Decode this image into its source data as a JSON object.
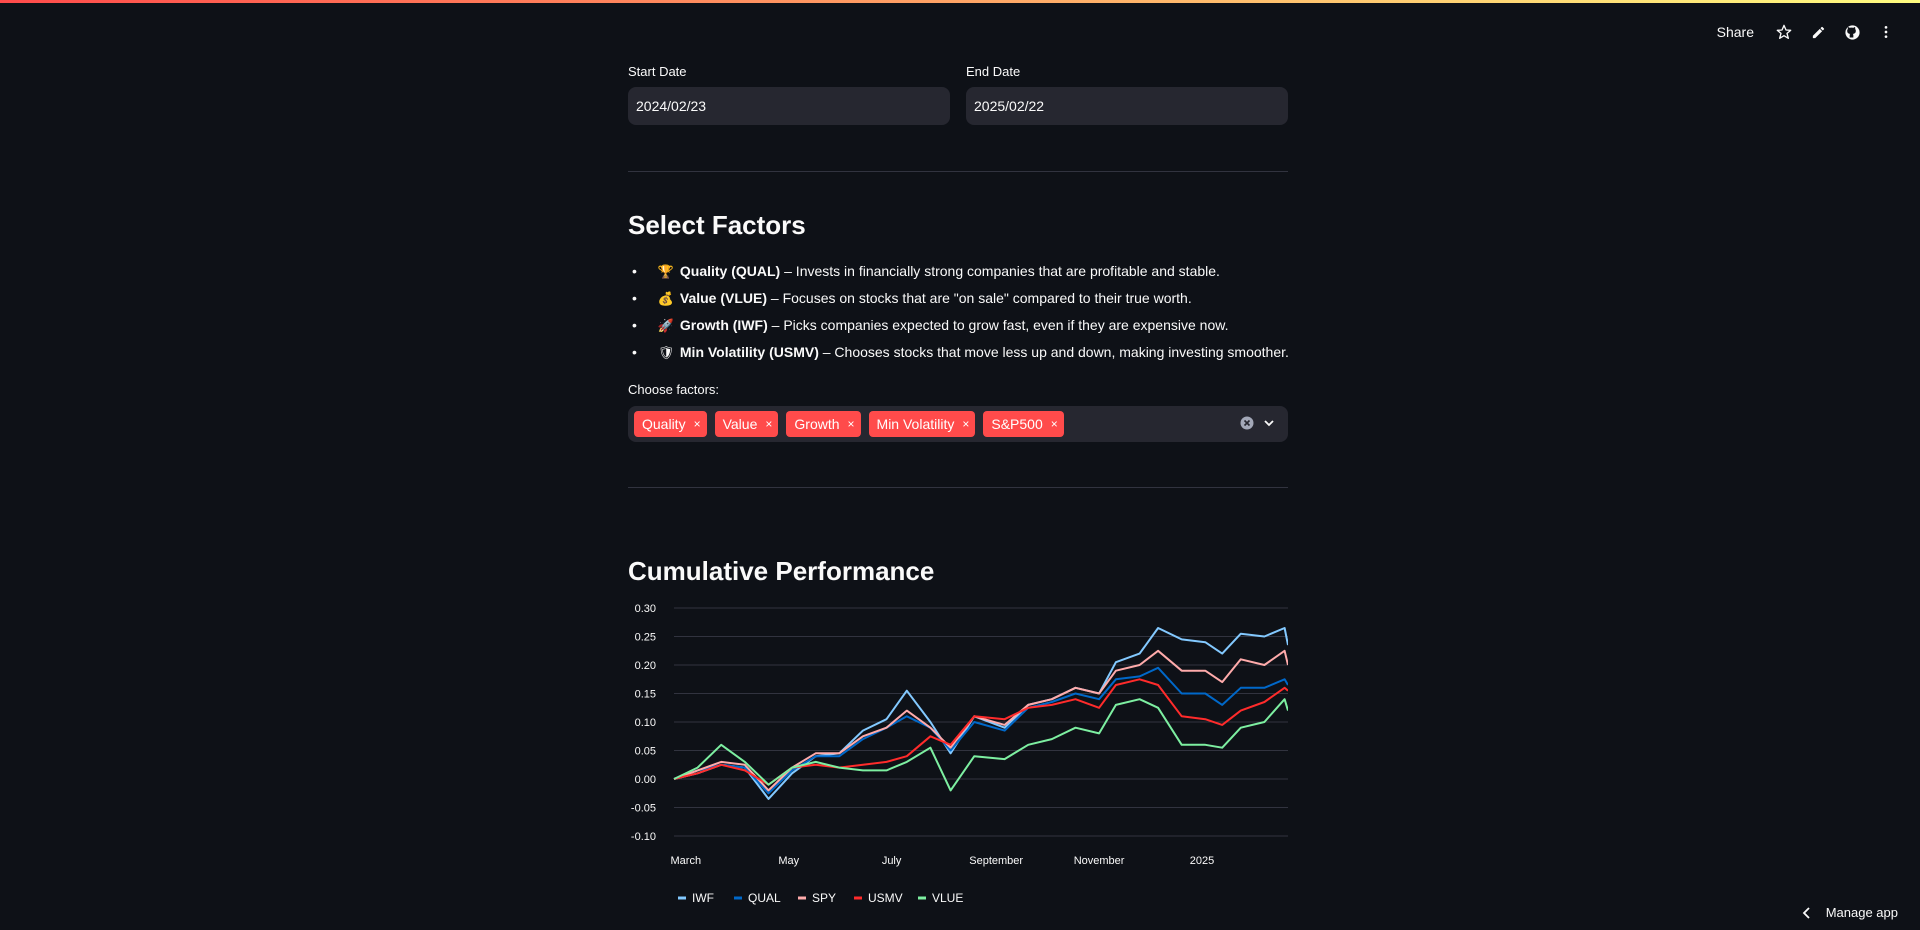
{
  "header": {
    "share_label": "Share",
    "icons": [
      "star-icon",
      "pencil-icon",
      "github-icon",
      "more-vertical-icon"
    ]
  },
  "dates": {
    "start_label": "Start Date",
    "start_value": "2024/02/23",
    "end_label": "End Date",
    "end_value": "2025/02/22"
  },
  "factors": {
    "title": "Select Factors",
    "items": [
      {
        "emoji": "🏆",
        "name": "Quality (QUAL)",
        "desc": "– Invests in financially strong companies that are profitable and stable."
      },
      {
        "emoji": "💰",
        "name": "Value (VLUE)",
        "desc": "– Focuses on stocks that are \"on sale\" compared to their true worth."
      },
      {
        "emoji": "🚀",
        "name": "Growth (IWF)",
        "desc": "– Picks companies expected to grow fast, even if they are expensive now."
      },
      {
        "emoji": "🛡",
        "name": "Min Volatility (USMV)",
        "desc": "– Chooses stocks that move less up and down, making investing smoother."
      }
    ],
    "choose_label": "Choose factors:",
    "selected": [
      "Quality",
      "Value",
      "Growth",
      "Min Volatility",
      "S&P500"
    ],
    "remove_glyph": "×"
  },
  "performance": {
    "title": "Cumulative Performance"
  },
  "chart_data": {
    "type": "line",
    "title": "",
    "xlabel": "",
    "ylabel": "",
    "x_ticks": [
      "March",
      "May",
      "July",
      "September",
      "November",
      "2025"
    ],
    "y_ticks": [
      "0.30",
      "0.25",
      "0.20",
      "0.15",
      "0.10",
      "0.05",
      "0.00",
      "-0.05",
      "-0.10"
    ],
    "ylim": [
      -0.1,
      0.3
    ],
    "xlim": [
      "2024-02-23",
      "2025-02-21"
    ],
    "grid": true,
    "legend": "bottom",
    "series": [
      {
        "name": "IWF",
        "color": "#83c9ff",
        "points": [
          [
            "2024-02-23",
            0.0
          ],
          [
            "2024-03-08",
            0.01
          ],
          [
            "2024-03-22",
            0.025
          ],
          [
            "2024-04-05",
            0.02
          ],
          [
            "2024-04-19",
            -0.035
          ],
          [
            "2024-05-03",
            0.01
          ],
          [
            "2024-05-17",
            0.04
          ],
          [
            "2024-05-31",
            0.045
          ],
          [
            "2024-06-14",
            0.085
          ],
          [
            "2024-06-28",
            0.105
          ],
          [
            "2024-07-10",
            0.155
          ],
          [
            "2024-07-24",
            0.1
          ],
          [
            "2024-08-05",
            0.045
          ],
          [
            "2024-08-19",
            0.11
          ],
          [
            "2024-09-06",
            0.09
          ],
          [
            "2024-09-20",
            0.13
          ],
          [
            "2024-10-04",
            0.14
          ],
          [
            "2024-10-18",
            0.16
          ],
          [
            "2024-11-01",
            0.15
          ],
          [
            "2024-11-11",
            0.205
          ],
          [
            "2024-11-25",
            0.22
          ],
          [
            "2024-12-06",
            0.265
          ],
          [
            "2024-12-20",
            0.245
          ],
          [
            "2025-01-03",
            0.24
          ],
          [
            "2025-01-13",
            0.22
          ],
          [
            "2025-01-24",
            0.255
          ],
          [
            "2025-02-07",
            0.25
          ],
          [
            "2025-02-19",
            0.265
          ],
          [
            "2025-02-21",
            0.235
          ]
        ]
      },
      {
        "name": "QUAL",
        "color": "#0068c9",
        "points": [
          [
            "2024-02-23",
            0.0
          ],
          [
            "2024-03-08",
            0.015
          ],
          [
            "2024-03-22",
            0.025
          ],
          [
            "2024-04-05",
            0.02
          ],
          [
            "2024-04-19",
            -0.025
          ],
          [
            "2024-05-03",
            0.015
          ],
          [
            "2024-05-17",
            0.04
          ],
          [
            "2024-05-31",
            0.04
          ],
          [
            "2024-06-14",
            0.07
          ],
          [
            "2024-06-28",
            0.09
          ],
          [
            "2024-07-10",
            0.11
          ],
          [
            "2024-07-24",
            0.09
          ],
          [
            "2024-08-05",
            0.05
          ],
          [
            "2024-08-19",
            0.1
          ],
          [
            "2024-09-06",
            0.085
          ],
          [
            "2024-09-20",
            0.125
          ],
          [
            "2024-10-04",
            0.135
          ],
          [
            "2024-10-18",
            0.15
          ],
          [
            "2024-11-01",
            0.14
          ],
          [
            "2024-11-11",
            0.175
          ],
          [
            "2024-11-25",
            0.18
          ],
          [
            "2024-12-06",
            0.195
          ],
          [
            "2024-12-20",
            0.15
          ],
          [
            "2025-01-03",
            0.15
          ],
          [
            "2025-01-13",
            0.13
          ],
          [
            "2025-01-24",
            0.16
          ],
          [
            "2025-02-07",
            0.16
          ],
          [
            "2025-02-19",
            0.175
          ],
          [
            "2025-02-21",
            0.165
          ]
        ]
      },
      {
        "name": "SPY",
        "color": "#ffabab",
        "points": [
          [
            "2024-02-23",
            0.0
          ],
          [
            "2024-03-08",
            0.015
          ],
          [
            "2024-03-22",
            0.03
          ],
          [
            "2024-04-05",
            0.025
          ],
          [
            "2024-04-19",
            -0.02
          ],
          [
            "2024-05-03",
            0.02
          ],
          [
            "2024-05-17",
            0.045
          ],
          [
            "2024-05-31",
            0.045
          ],
          [
            "2024-06-14",
            0.075
          ],
          [
            "2024-06-28",
            0.09
          ],
          [
            "2024-07-10",
            0.12
          ],
          [
            "2024-07-24",
            0.09
          ],
          [
            "2024-08-05",
            0.055
          ],
          [
            "2024-08-19",
            0.11
          ],
          [
            "2024-09-06",
            0.095
          ],
          [
            "2024-09-20",
            0.13
          ],
          [
            "2024-10-04",
            0.14
          ],
          [
            "2024-10-18",
            0.16
          ],
          [
            "2024-11-01",
            0.15
          ],
          [
            "2024-11-11",
            0.19
          ],
          [
            "2024-11-25",
            0.2
          ],
          [
            "2024-12-06",
            0.225
          ],
          [
            "2024-12-20",
            0.19
          ],
          [
            "2025-01-03",
            0.19
          ],
          [
            "2025-01-13",
            0.17
          ],
          [
            "2025-01-24",
            0.21
          ],
          [
            "2025-02-07",
            0.2
          ],
          [
            "2025-02-19",
            0.225
          ],
          [
            "2025-02-21",
            0.2
          ]
        ]
      },
      {
        "name": "USMV",
        "color": "#ff2b2b",
        "points": [
          [
            "2024-02-23",
            0.0
          ],
          [
            "2024-03-08",
            0.01
          ],
          [
            "2024-03-22",
            0.025
          ],
          [
            "2024-04-05",
            0.015
          ],
          [
            "2024-04-19",
            -0.01
          ],
          [
            "2024-05-03",
            0.02
          ],
          [
            "2024-05-17",
            0.025
          ],
          [
            "2024-05-31",
            0.02
          ],
          [
            "2024-06-14",
            0.025
          ],
          [
            "2024-06-28",
            0.03
          ],
          [
            "2024-07-10",
            0.04
          ],
          [
            "2024-07-24",
            0.075
          ],
          [
            "2024-08-05",
            0.06
          ],
          [
            "2024-08-19",
            0.11
          ],
          [
            "2024-09-06",
            0.105
          ],
          [
            "2024-09-20",
            0.125
          ],
          [
            "2024-10-04",
            0.13
          ],
          [
            "2024-10-18",
            0.14
          ],
          [
            "2024-11-01",
            0.125
          ],
          [
            "2024-11-11",
            0.165
          ],
          [
            "2024-11-25",
            0.175
          ],
          [
            "2024-12-06",
            0.165
          ],
          [
            "2024-12-20",
            0.11
          ],
          [
            "2025-01-03",
            0.105
          ],
          [
            "2025-01-13",
            0.095
          ],
          [
            "2025-01-24",
            0.12
          ],
          [
            "2025-02-07",
            0.135
          ],
          [
            "2025-02-19",
            0.16
          ],
          [
            "2025-02-21",
            0.155
          ]
        ]
      },
      {
        "name": "VLUE",
        "color": "#7defa1",
        "points": [
          [
            "2024-02-23",
            0.0
          ],
          [
            "2024-03-08",
            0.02
          ],
          [
            "2024-03-22",
            0.06
          ],
          [
            "2024-04-05",
            0.03
          ],
          [
            "2024-04-19",
            -0.01
          ],
          [
            "2024-05-03",
            0.02
          ],
          [
            "2024-05-17",
            0.03
          ],
          [
            "2024-05-31",
            0.02
          ],
          [
            "2024-06-14",
            0.015
          ],
          [
            "2024-06-28",
            0.015
          ],
          [
            "2024-07-10",
            0.03
          ],
          [
            "2024-07-24",
            0.055
          ],
          [
            "2024-08-05",
            -0.02
          ],
          [
            "2024-08-19",
            0.04
          ],
          [
            "2024-09-06",
            0.035
          ],
          [
            "2024-09-20",
            0.06
          ],
          [
            "2024-10-04",
            0.07
          ],
          [
            "2024-10-18",
            0.09
          ],
          [
            "2024-11-01",
            0.08
          ],
          [
            "2024-11-11",
            0.13
          ],
          [
            "2024-11-25",
            0.14
          ],
          [
            "2024-12-06",
            0.125
          ],
          [
            "2024-12-20",
            0.06
          ],
          [
            "2025-01-03",
            0.06
          ],
          [
            "2025-01-13",
            0.055
          ],
          [
            "2025-01-24",
            0.09
          ],
          [
            "2025-02-07",
            0.1
          ],
          [
            "2025-02-19",
            0.14
          ],
          [
            "2025-02-21",
            0.12
          ]
        ]
      }
    ]
  },
  "footer": {
    "manage_label": "Manage app"
  }
}
